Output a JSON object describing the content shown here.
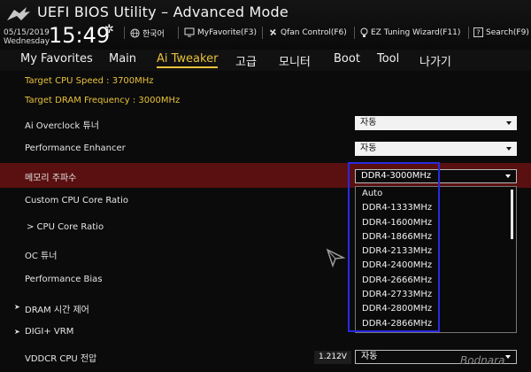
{
  "header": {
    "title": "UEFI BIOS Utility – Advanced Mode",
    "date": "05/15/2019",
    "weekday": "Wednesday",
    "time": "15:49",
    "tools": [
      {
        "label": "한국어",
        "icon": "globe-icon"
      },
      {
        "label": "MyFavorite(F3)",
        "icon": "favorite-icon"
      },
      {
        "label": "Qfan Control(F6)",
        "icon": "fan-icon"
      },
      {
        "label": "EZ Tuning Wizard(F11)",
        "icon": "bulb-icon"
      },
      {
        "label": "Search(F9)",
        "icon": "search-icon"
      }
    ]
  },
  "menu": {
    "tabs": [
      "My Favorites",
      "Main",
      "Ai Tweaker",
      "고급",
      "모니터",
      "Boot",
      "Tool",
      "나가기"
    ],
    "active": "Ai Tweaker"
  },
  "info": {
    "cpu_speed": "Target CPU Speed : 3700MHz",
    "dram_freq": "Target DRAM Frequency : 3000MHz"
  },
  "settings": [
    {
      "label": "Ai Overclock 튜너",
      "value": "자동"
    },
    {
      "label": "Performance Enhancer",
      "value": "자동"
    },
    {
      "label": "메모리 주파수",
      "value": "DDR4-3000MHz"
    },
    {
      "label": "Custom CPU Core Ratio"
    },
    {
      "label": "> CPU Core Ratio"
    },
    {
      "label": "OC 튜너"
    },
    {
      "label": "Performance Bias"
    },
    {
      "label": "DRAM 시간 제어"
    },
    {
      "label": "DIGI+ VRM"
    },
    {
      "label": "VDDCR CPU 전압",
      "value": "자동",
      "voltage": "1.212V"
    }
  ],
  "dropdown_options": [
    "Auto",
    "DDR4-1333MHz",
    "DDR4-1600MHz",
    "DDR4-1866MHz",
    "DDR4-2133MHz",
    "DDR4-2400MHz",
    "DDR4-2666MHz",
    "DDR4-2733MHz",
    "DDR4-2800MHz",
    "DDR4-2866MHz"
  ],
  "watermark": "Bodnara",
  "colors": {
    "accent": "#e8c23c",
    "highlight_row": "#5a1010",
    "annotation_box": "#2a2ae0"
  }
}
